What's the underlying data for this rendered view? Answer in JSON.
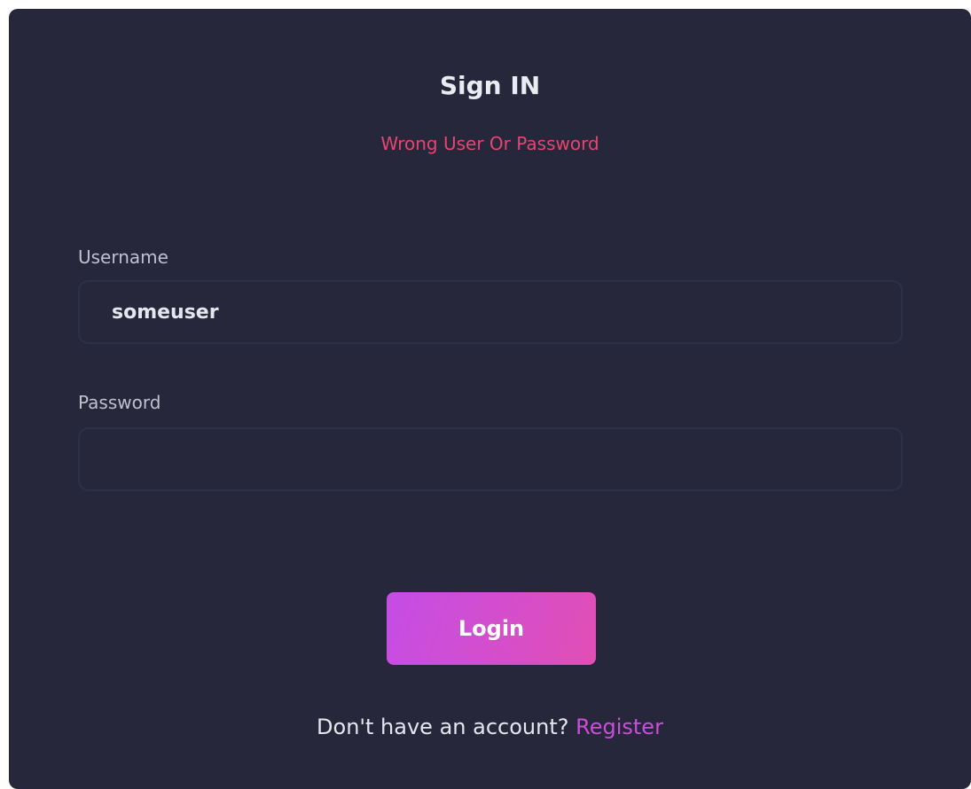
{
  "form": {
    "title": "Sign IN",
    "error_message": "Wrong User Or Password",
    "username_label": "Username",
    "username_value": "someuser",
    "password_label": "Password",
    "password_value": "",
    "login_label": "Login",
    "footer_prefix": "Don't have an account?",
    "register_label": "Register"
  },
  "colors": {
    "background": "#26273b",
    "error": "#e8456e",
    "accent": "#c84fd8"
  }
}
